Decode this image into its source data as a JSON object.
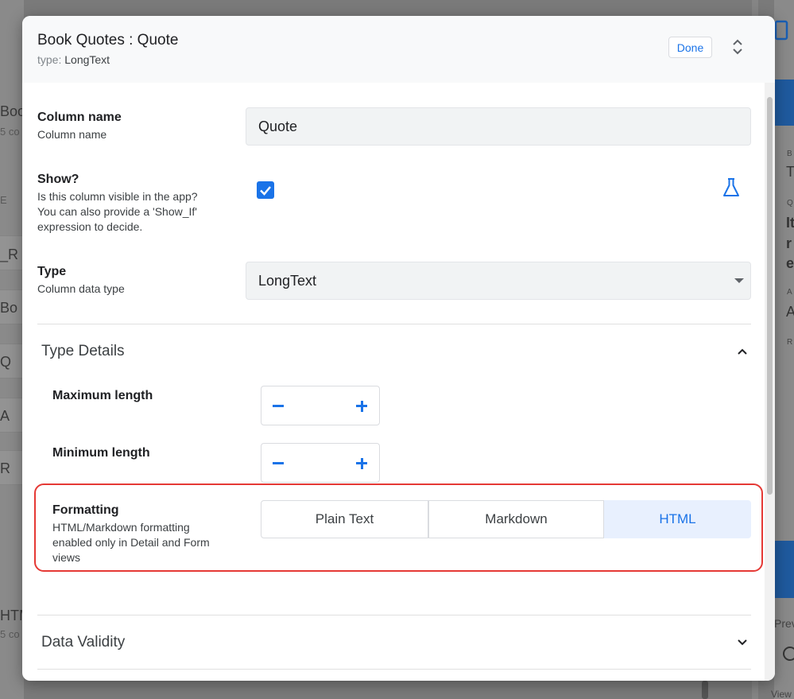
{
  "background": {
    "left_texts": [
      "Boo",
      "5 co",
      "E",
      "_R",
      "Bo",
      "Q",
      "A",
      "R",
      "HTM",
      "5 co"
    ],
    "right_texts": [
      "B",
      "T",
      "Q",
      "It",
      "r",
      "e",
      "A",
      "A",
      "R",
      "Prev",
      "View"
    ]
  },
  "dialog": {
    "title": "Book Quotes : Quote",
    "type_prefix": "type:",
    "type_value": "LongText",
    "done_label": "Done"
  },
  "fields": {
    "column_name": {
      "label": "Column name",
      "description": "Column name",
      "value": "Quote"
    },
    "show": {
      "label": "Show?",
      "description_lines": [
        "Is this column visible in the app?",
        "You can also provide a 'Show_If'",
        "expression to decide."
      ],
      "checked": true
    },
    "type": {
      "label": "Type",
      "description": "Column data type",
      "value": "LongText"
    }
  },
  "type_details": {
    "title": "Type Details",
    "max_length": {
      "label": "Maximum length"
    },
    "min_length": {
      "label": "Minimum length"
    },
    "formatting": {
      "label": "Formatting",
      "description_lines": [
        "HTML/Markdown formatting",
        "enabled only in Detail and Form",
        "views"
      ],
      "options": [
        "Plain Text",
        "Markdown",
        "HTML"
      ],
      "selected": "HTML"
    }
  },
  "data_validity": {
    "title": "Data Validity"
  },
  "colors": {
    "accent": "#1a73e8",
    "highlight": "#e53935",
    "selected_bg": "#e8f0fe"
  }
}
